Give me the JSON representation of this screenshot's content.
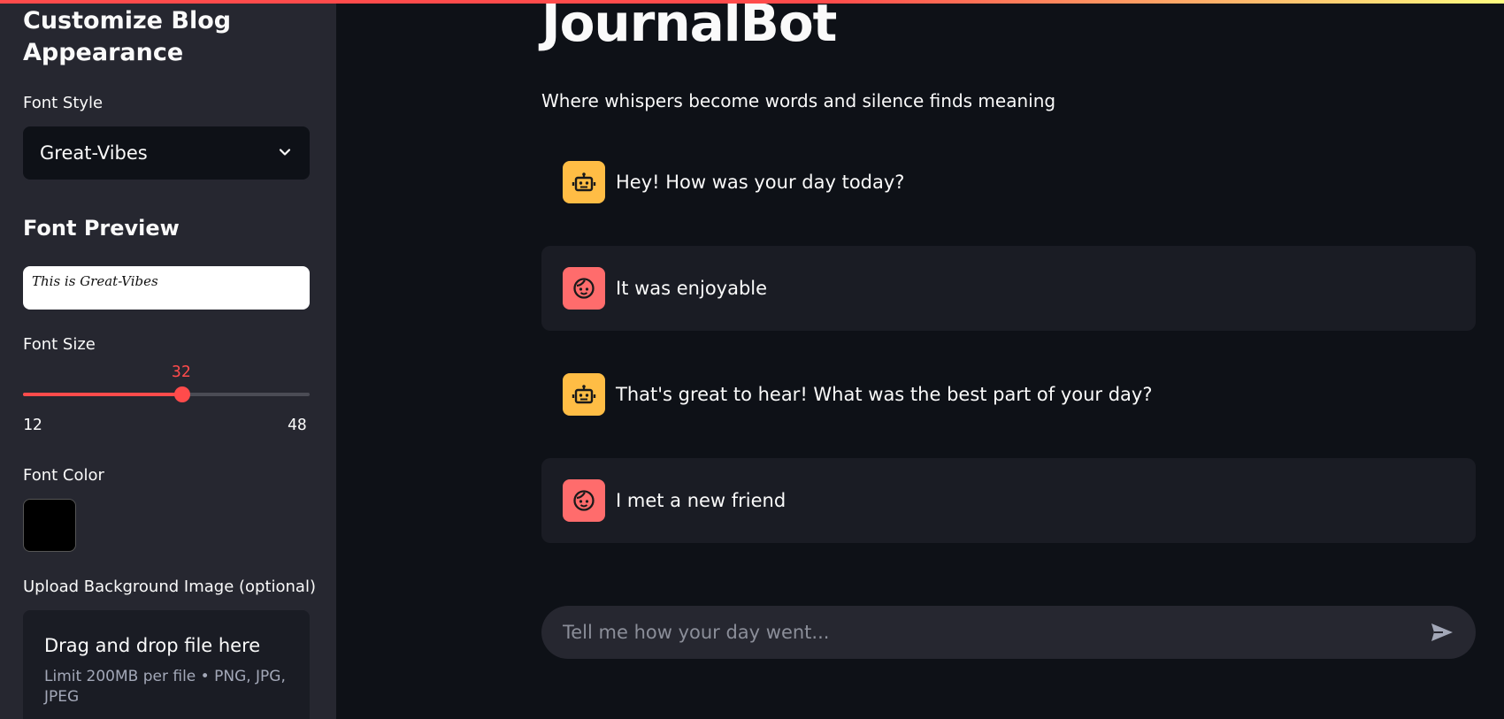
{
  "sidebar": {
    "title": "Customize Blog Appearance",
    "font_style": {
      "label": "Font Style",
      "selected": "Great-Vibes"
    },
    "font_preview": {
      "heading": "Font Preview",
      "text": "This is Great-Vibes"
    },
    "font_size": {
      "label": "Font Size",
      "value": "32",
      "min": "12",
      "max": "48",
      "fraction": 0.556
    },
    "font_color": {
      "label": "Font Color",
      "value": "#000000"
    },
    "upload": {
      "label": "Upload Background Image (optional)",
      "drop_title": "Drag and drop file here",
      "drop_sub": "Limit 200MB per file • PNG, JPG, JPEG"
    }
  },
  "main": {
    "title": "JournalBot",
    "subtitle": "Where whispers become words and silence finds meaning",
    "messages": [
      {
        "role": "assistant",
        "text": "Hey! How was your day today?"
      },
      {
        "role": "user",
        "text": "It was enjoyable"
      },
      {
        "role": "assistant",
        "text": "That's great to hear! What was the best part of your day?"
      },
      {
        "role": "user",
        "text": "I met a new friend"
      }
    ],
    "chat_input": {
      "placeholder": "Tell me how your day went..."
    }
  },
  "colors": {
    "accent": "#ff4b4b",
    "bot_avatar": "#ffbd45",
    "user_avatar": "#ff6c6c",
    "background": "#0e1117",
    "sidebar": "#262730"
  },
  "icons": {
    "dropdown": "chevron-down-icon",
    "bot": "robot-icon",
    "user": "user-face-icon",
    "send": "send-icon"
  }
}
